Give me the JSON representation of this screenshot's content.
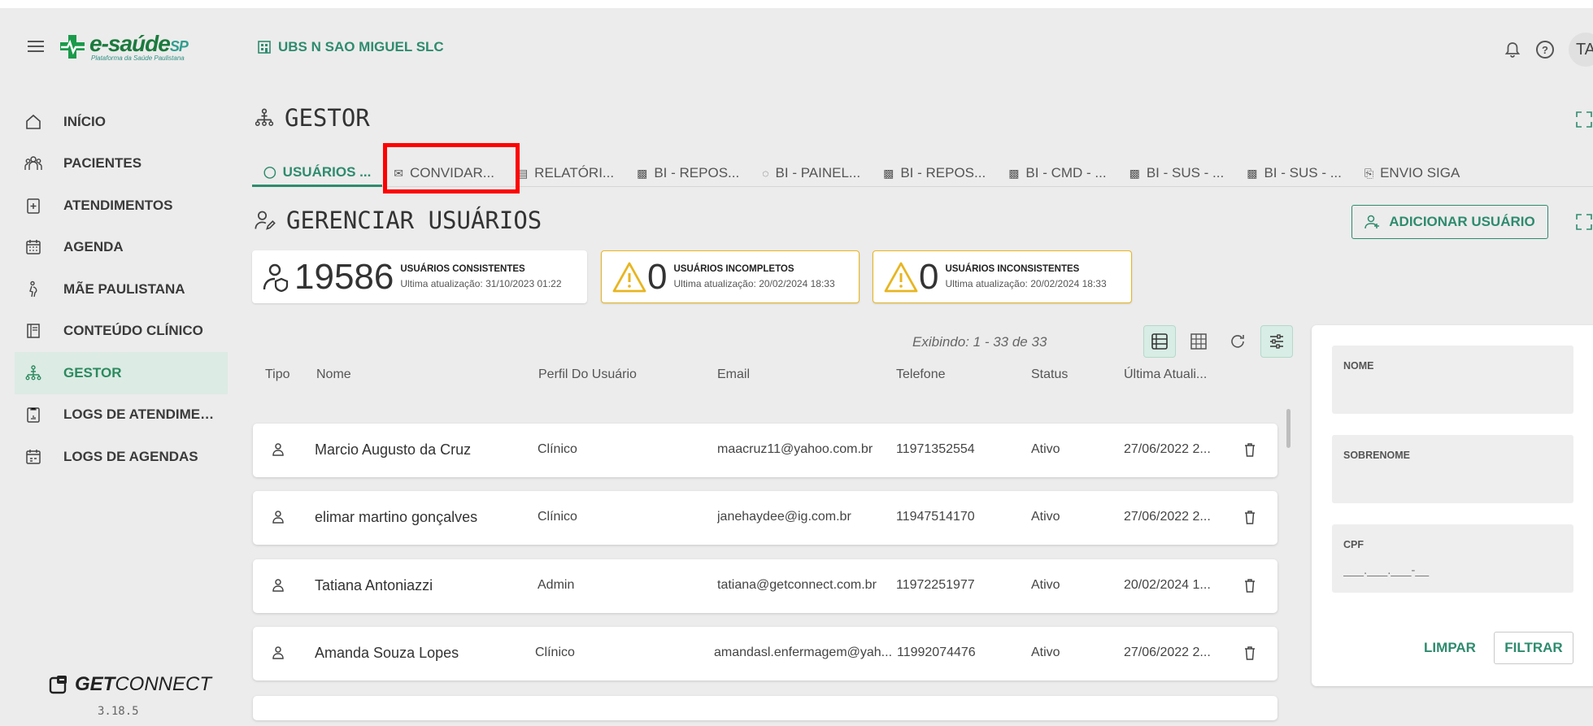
{
  "header": {
    "logo_brand": "e-saúde",
    "logo_brand_suffix": "SP",
    "logo_tagline": "Plataforma da Saúde Paulistana",
    "unit_name": "UBS N SAO MIGUEL SLC",
    "avatar_initials": "TA"
  },
  "sidebar": {
    "items": [
      {
        "label": "INÍCIO",
        "icon": "home-icon"
      },
      {
        "label": "PACIENTES",
        "icon": "group-icon"
      },
      {
        "label": "ATENDIMENTOS",
        "icon": "clipboard-plus-icon"
      },
      {
        "label": "AGENDA",
        "icon": "calendar-icon"
      },
      {
        "label": "MÃE PAULISTANA",
        "icon": "pregnant-icon"
      },
      {
        "label": "CONTEÚDO CLÍNICO",
        "icon": "book-icon"
      },
      {
        "label": "GESTOR",
        "icon": "hierarchy-icon",
        "active": true
      },
      {
        "label": "LOGS DE ATENDIME…",
        "icon": "clipboard-log-icon"
      },
      {
        "label": "LOGS DE AGENDAS",
        "icon": "calendar-log-icon"
      }
    ],
    "footer_brand_bold": "GET",
    "footer_brand_light": "CONNECT",
    "version": "3.18.5"
  },
  "page": {
    "title": "GESTOR",
    "tabs": [
      {
        "label": "USUÁRIOS ...",
        "icon": "person-icon",
        "active": true
      },
      {
        "label": "CONVIDAR...",
        "icon": "invite-icon"
      },
      {
        "label": "RELATÓRI...",
        "icon": "report-icon"
      },
      {
        "label": "BI - REPOS...",
        "icon": "bi-icon"
      },
      {
        "label": "BI - PAINEL...",
        "icon": "gauge-icon"
      },
      {
        "label": "BI - REPOS...",
        "icon": "bi-icon"
      },
      {
        "label": "BI - CMD - ...",
        "icon": "bi-icon"
      },
      {
        "label": "BI - SUS - ...",
        "icon": "bi-icon"
      },
      {
        "label": "BI - SUS - ...",
        "icon": "bi-icon"
      },
      {
        "label": "ENVIO SIGA",
        "icon": "clipboard-icon"
      }
    ],
    "section_title": "GERENCIAR USUÁRIOS",
    "add_user_label": "ADICIONAR USUÁRIO"
  },
  "stats": [
    {
      "value": "19586",
      "title": "USUÁRIOS CONSISTENTES",
      "updated": "Ultima atualização: 31/10/2023 01:22"
    },
    {
      "value": "0",
      "title": "USUÁRIOS INCOMPLETOS",
      "updated": "Ultima atualização: 20/02/2024 18:33"
    },
    {
      "value": "0",
      "title": "USUÁRIOS INCONSISTENTES",
      "updated": "Ultima atualização: 20/02/2024 18:33"
    }
  ],
  "table": {
    "showing": "Exibindo: 1 - 33 de 33",
    "columns": [
      "Tipo",
      "Nome",
      "Perfil Do Usuário",
      "Email",
      "Telefone",
      "Status",
      "Última Atuali..."
    ],
    "rows": [
      {
        "name": "Marcio Augusto da Cruz",
        "profile": "Clínico",
        "email": "maacruz11@yahoo.com.br",
        "phone": "11971352554",
        "status": "Ativo",
        "updated": "27/06/2022 2..."
      },
      {
        "name": "elimar martino gonçalves",
        "profile": "Clínico",
        "email": "janehaydee@ig.com.br",
        "phone": "11947514170",
        "status": "Ativo",
        "updated": "27/06/2022 2..."
      },
      {
        "name": "Tatiana Antoniazzi",
        "profile": "Admin",
        "email": "tatiana@getconnect.com.br",
        "phone": "11972251977",
        "status": "Ativo",
        "updated": "20/02/2024 1..."
      },
      {
        "name": "Amanda Souza Lopes",
        "profile": "Clínico",
        "email": "amandasl.enfermagem@yah...",
        "phone": "11992074476",
        "status": "Ativo",
        "updated": "27/06/2022 2..."
      }
    ]
  },
  "filter": {
    "nome_label": "NOME",
    "sobrenome_label": "SOBRENOME",
    "cpf_label": "CPF",
    "cpf_placeholder": "___.___.___-__",
    "clear_label": "LIMPAR",
    "filter_label": "FILTRAR"
  }
}
